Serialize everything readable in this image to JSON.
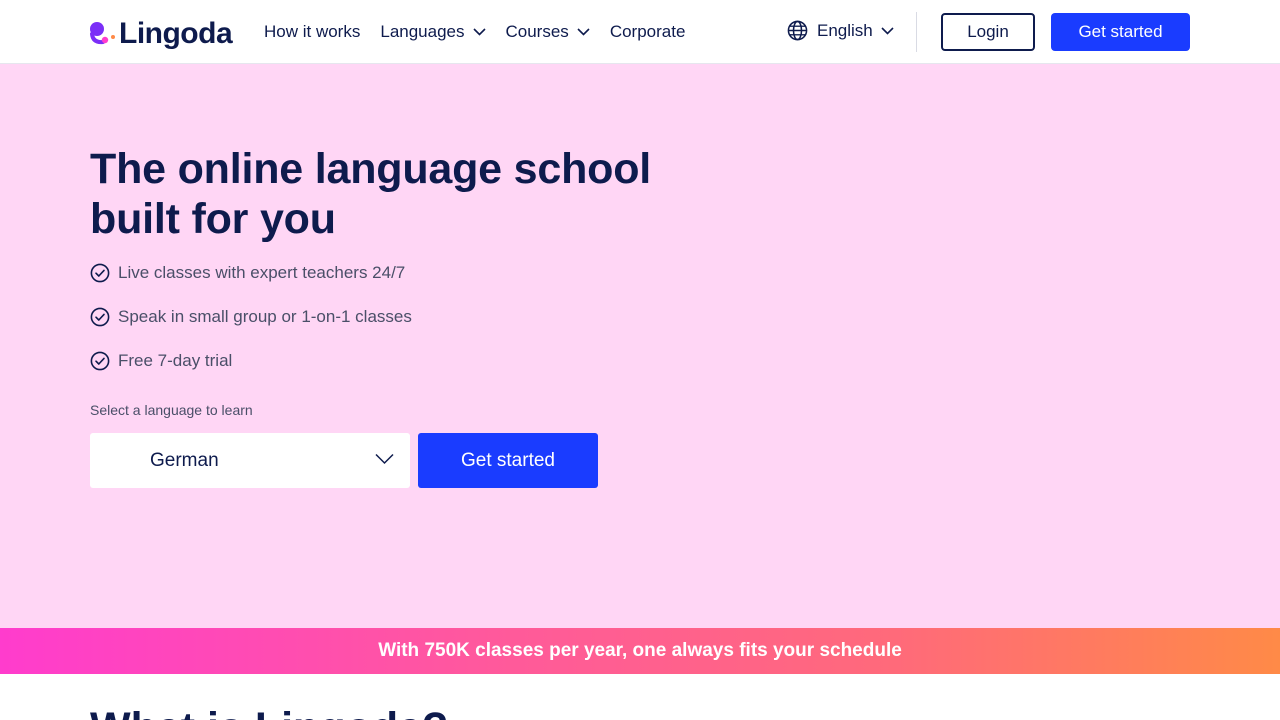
{
  "header": {
    "logo_text": "Lingoda",
    "nav": [
      {
        "label": "How it works",
        "has_dropdown": false
      },
      {
        "label": "Languages",
        "has_dropdown": true
      },
      {
        "label": "Courses",
        "has_dropdown": true
      },
      {
        "label": "Corporate",
        "has_dropdown": false
      }
    ],
    "site_language": "English",
    "login_label": "Login",
    "cta_label": "Get started"
  },
  "hero": {
    "title": "The online language school built for you",
    "features": [
      "Live classes with expert teachers 24/7",
      "Speak in small group or 1-on-1 classes",
      "Free 7-day trial"
    ],
    "select_label": "Select a language to learn",
    "selected_language": "German",
    "cta_label": "Get started"
  },
  "banner": {
    "text": "With 750K classes per year, one always fits your schedule"
  },
  "next_section": {
    "title_partial": "What is Lingoda?"
  },
  "colors": {
    "navy": "#0e1b4d",
    "primary_blue": "#1a3cff",
    "hero_pink": "#ffd6f5",
    "banner_gradient_start": "#ff3ccd",
    "banner_gradient_end": "#ff8a47",
    "logo_purple": "#7b2ff7",
    "logo_pink": "#ff3ccd"
  },
  "icons": {
    "nav_dropdown": "chevron-down-icon",
    "language": "globe-icon",
    "feature": "check-circle-icon",
    "select": "chevron-down-icon"
  }
}
